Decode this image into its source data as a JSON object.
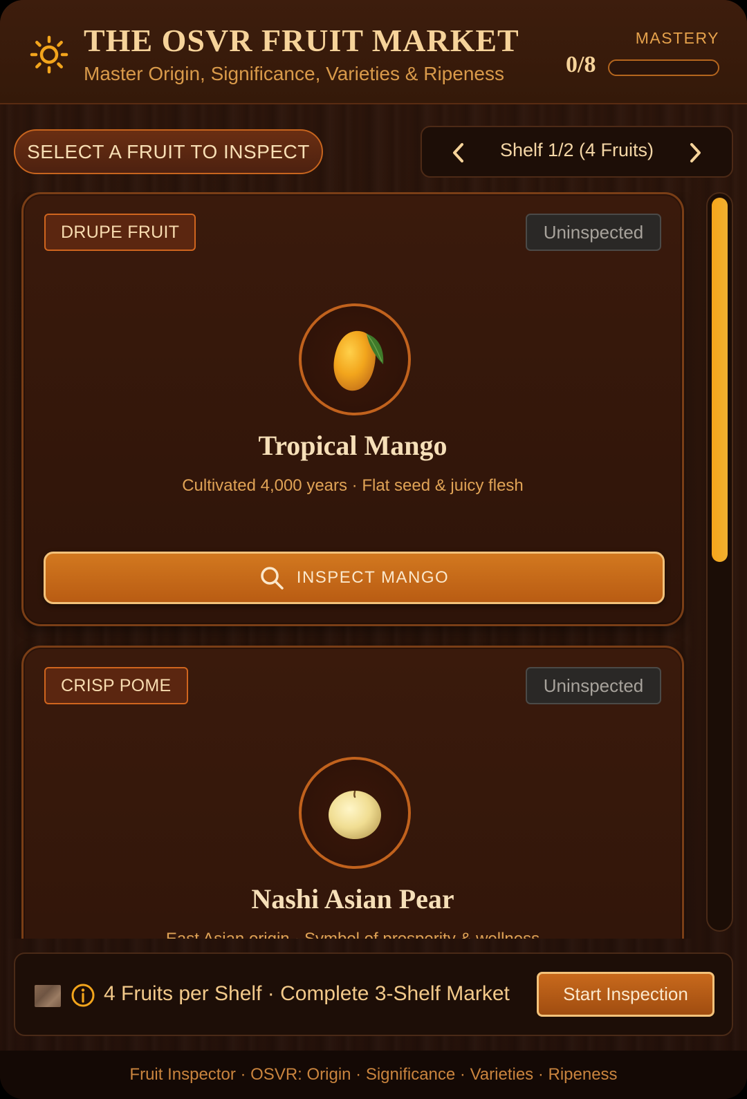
{
  "header": {
    "icon": "sun-icon",
    "title": "THE OSVR FRUIT MARKET",
    "subtitle": "Master Origin, Significance, Varieties & Ripeness",
    "mastery_label": "MASTERY",
    "mastery_count": "0/8",
    "mastery_progress": 0
  },
  "controls": {
    "select_label": "SELECT A FRUIT TO INSPECT",
    "shelf_label": "Shelf 1/2 (4 Fruits)",
    "prev_icon": "chevron-left-icon",
    "next_icon": "chevron-right-icon"
  },
  "cards": [
    {
      "tag": "DRUPE FRUIT",
      "status": "Uninspected",
      "image": "mango",
      "name": "Tropical Mango",
      "description": "Cultivated 4,000 years · Flat seed & juicy flesh",
      "button_label": "INSPECT MANGO"
    },
    {
      "tag": "CRISP POME",
      "status": "Uninspected",
      "image": "asian-pear",
      "name": "Nashi Asian Pear",
      "description": "East Asian origin · Symbol of prosperity & wellness"
    }
  ],
  "bottom_bar": {
    "info_text": "4 Fruits per Shelf · Complete 3-Shelf Market",
    "start_label": "Start Inspection"
  },
  "footer": {
    "text": "Fruit Inspector · OSVR: Origin · Significance · Varieties · Ripeness"
  },
  "colors": {
    "accent": "#f3a51c",
    "button": "#c8691c",
    "background": "#2a140a"
  }
}
